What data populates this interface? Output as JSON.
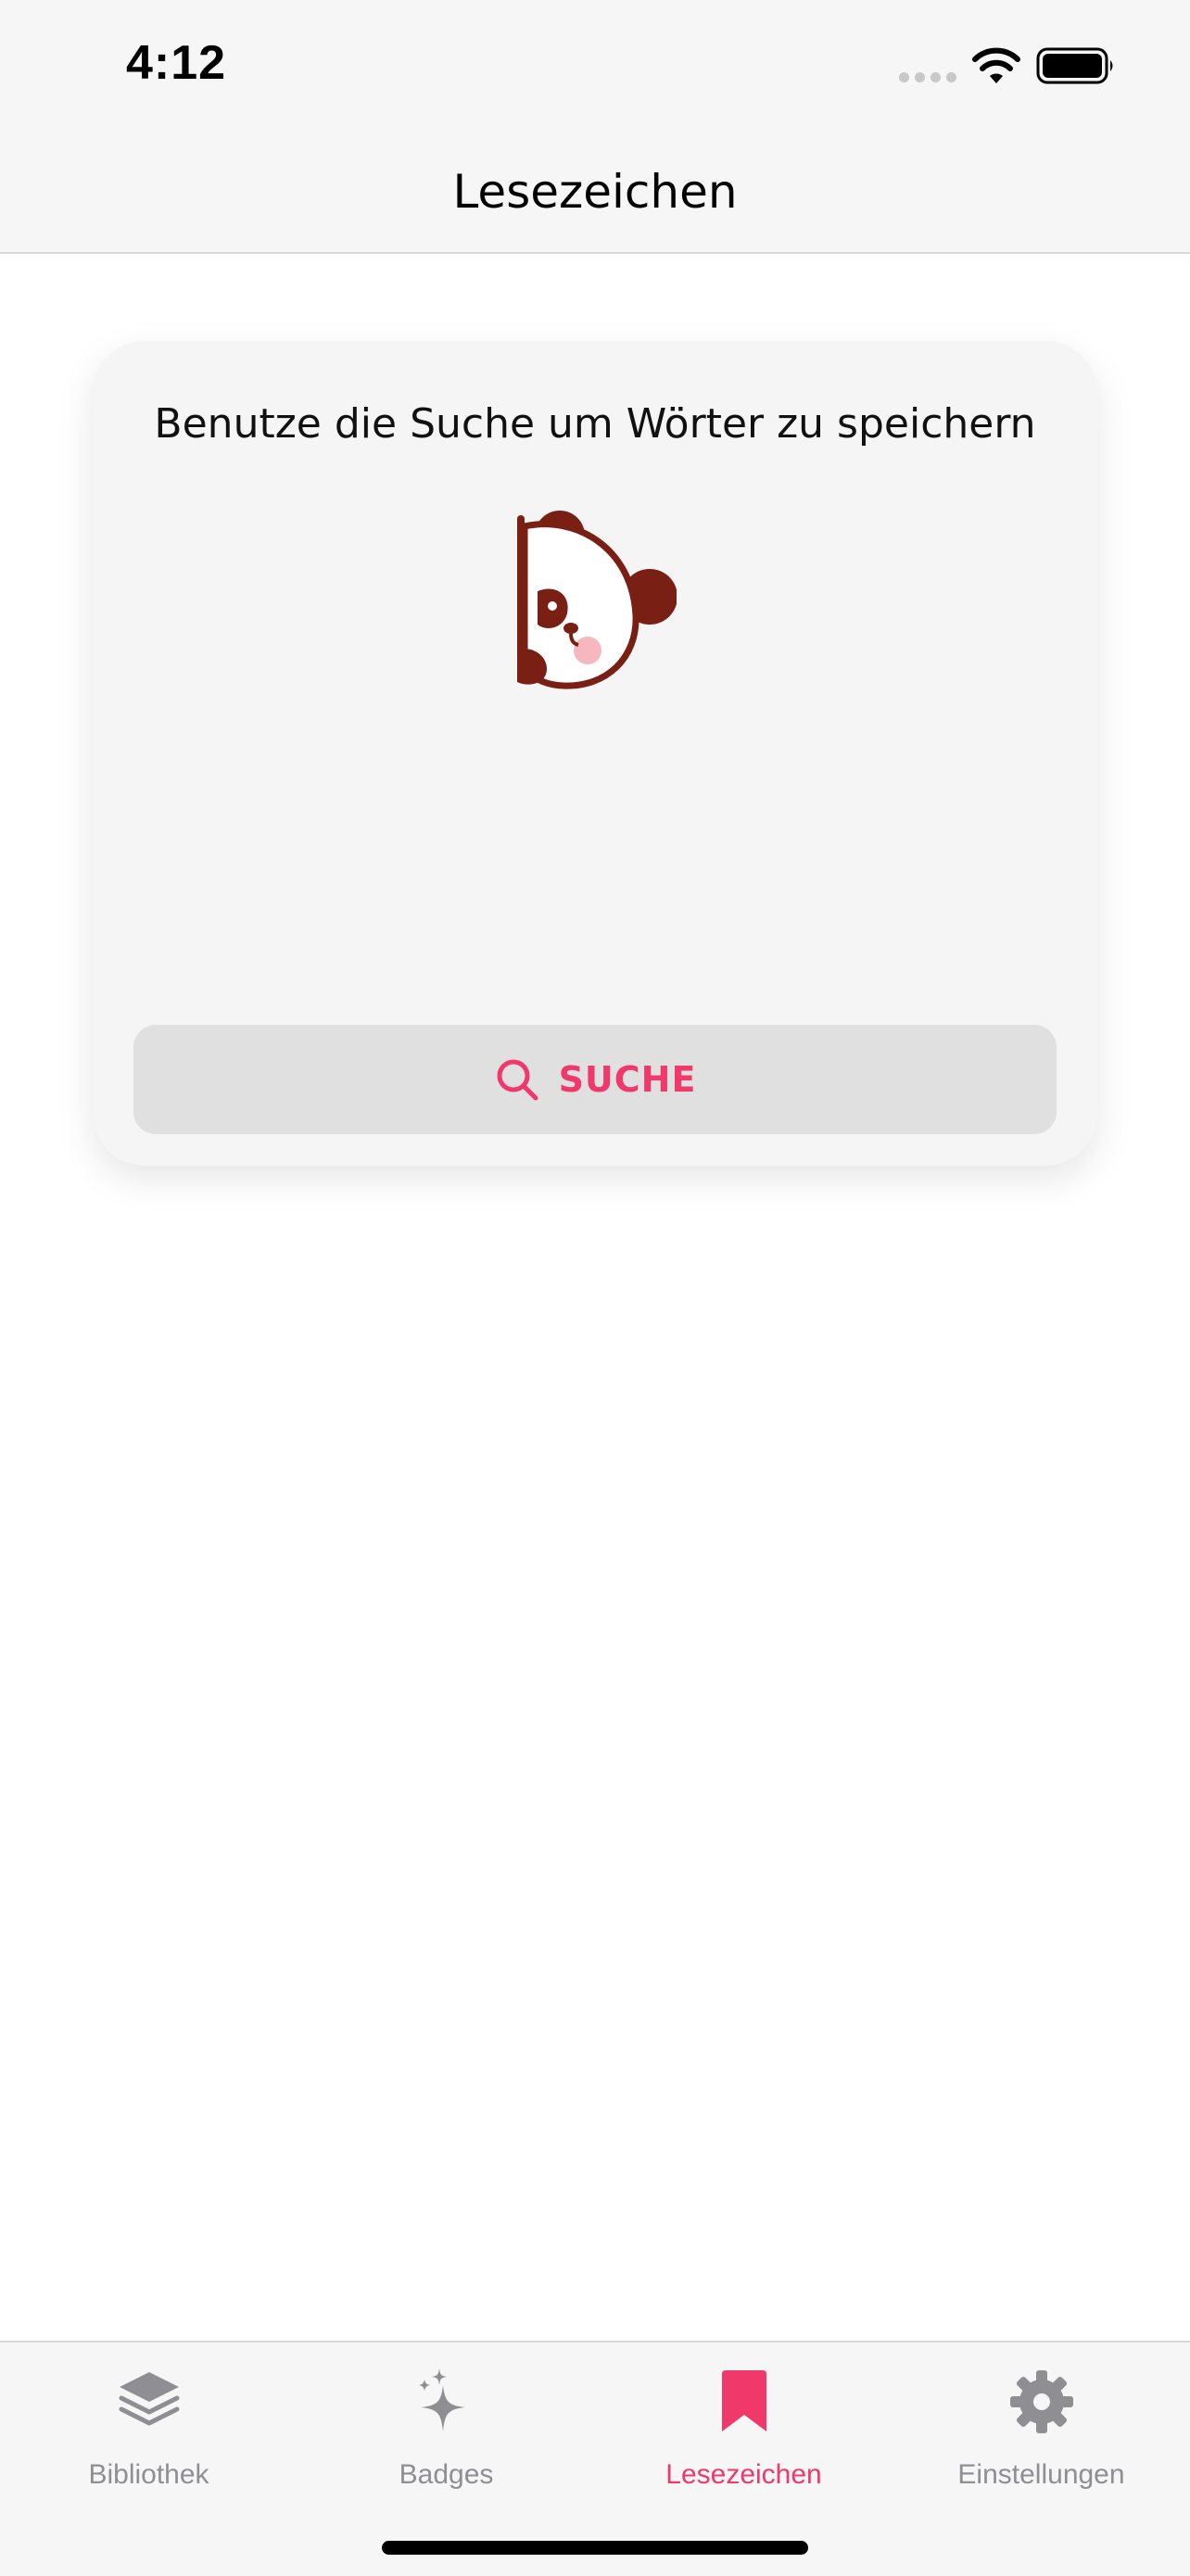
{
  "status_bar": {
    "time": "4:12"
  },
  "nav": {
    "title": "Lesezeichen"
  },
  "empty_state": {
    "message": "Benutze die Suche um Wörter zu speichern",
    "illustration": "panda-peeking-icon",
    "search_button_label": "SUCHE",
    "search_icon": "search-icon"
  },
  "tab_bar": {
    "tabs": [
      {
        "label": "Bibliothek",
        "icon": "stack-icon",
        "active": false
      },
      {
        "label": "Badges",
        "icon": "sparkle-icon",
        "active": false
      },
      {
        "label": "Lesezeichen",
        "icon": "bookmark-icon",
        "active": true
      },
      {
        "label": "Einstellungen",
        "icon": "gear-icon",
        "active": false
      }
    ]
  },
  "colors": {
    "accent": "#f0386b",
    "inactive": "#8e8e93",
    "bar_background": "#f6f6f6",
    "card_background": "#f5f5f5",
    "button_background": "#e0e0e0",
    "panda_dark": "#7a1f14"
  }
}
